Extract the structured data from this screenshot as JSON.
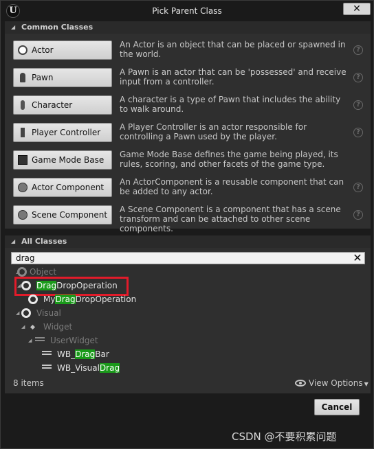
{
  "window": {
    "title": "Pick Parent Class",
    "logo_letter": "U",
    "close_symbol": "✕"
  },
  "common": {
    "header": "Common Classes",
    "items": [
      {
        "label": "Actor",
        "icon": "actor-icon",
        "description": "An Actor is an object that can be placed or spawned in the world."
      },
      {
        "label": "Pawn",
        "icon": "pawn-icon",
        "description": "A Pawn is an actor that can be 'possessed' and receive input from a controller."
      },
      {
        "label": "Character",
        "icon": "character-icon",
        "description": "A character is a type of Pawn that includes the ability to walk around."
      },
      {
        "label": "Player Controller",
        "icon": "player-controller-icon",
        "description": "A Player Controller is an actor responsible for controlling a Pawn used by the player."
      },
      {
        "label": "Game Mode Base",
        "icon": "game-mode-icon",
        "description": "Game Mode Base defines the game being played, its rules, scoring, and other facets of the game type."
      },
      {
        "label": "Actor Component",
        "icon": "actor-component-icon",
        "description": "An ActorComponent is a reusable component that can be added to any actor."
      },
      {
        "label": "Scene Component",
        "icon": "scene-component-icon",
        "description": "A Scene Component is a component that has a scene transform and can be attached to other scene components."
      }
    ],
    "help_symbol": "?"
  },
  "all": {
    "header": "All Classes",
    "search_value": "drag",
    "search_clear": "✕",
    "tree": {
      "object": "Object",
      "dragdrop_match": "Drag",
      "dragdrop_rest": "DropOperation",
      "my_prefix": "My",
      "my_match": "Drag",
      "my_rest": "DropOperation",
      "visual": "Visual",
      "widget": "Widget",
      "userwidget": "UserWidget",
      "wbdragbar_prefix": "WB_",
      "wbdragbar_match": "Drag",
      "wbdragbar_rest": "Bar",
      "wbvisual_prefix": "WB_Visual",
      "wbvisual_match": "Drag"
    },
    "items_count": "8 items",
    "view_options": "View Options"
  },
  "footer": {
    "cancel": "Cancel"
  },
  "watermark": "CSDN @不要积累问题",
  "colors": {
    "highlight": "#1a9a1a",
    "annotation_box": "#e21b2a"
  }
}
